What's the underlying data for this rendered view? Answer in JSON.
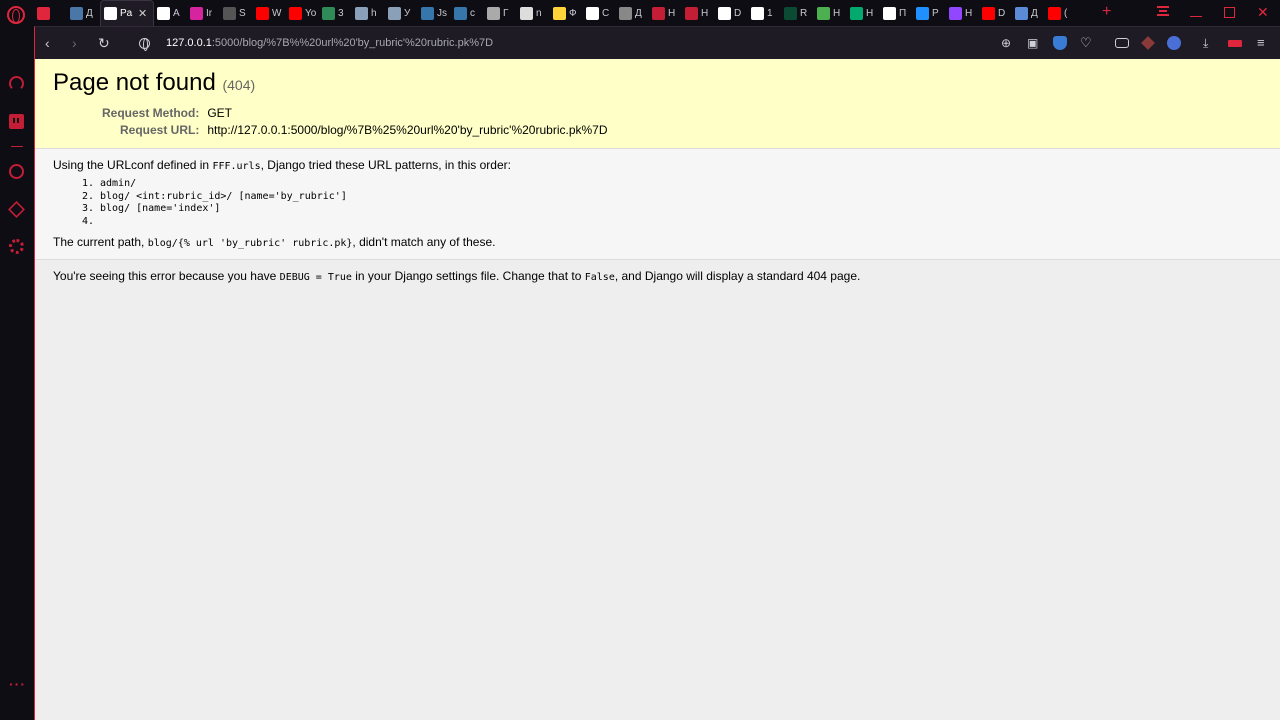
{
  "browser": {
    "tabs": [
      {
        "title": "",
        "favicon": "gamepad-icon",
        "color": "#e0263d"
      },
      {
        "title": "Д",
        "favicon": "vk-icon",
        "color": "#4a76a8"
      },
      {
        "title": "Pa",
        "favicon": "page-icon",
        "color": "#ffffff",
        "active": true
      },
      {
        "title": "A",
        "favicon": "page-icon",
        "color": "#ffffff"
      },
      {
        "title": "Ir",
        "favicon": "instagram-icon",
        "color": "#d6249f"
      },
      {
        "title": "S",
        "favicon": "gear-icon",
        "color": "#555555"
      },
      {
        "title": "W",
        "favicon": "youtube-icon",
        "color": "#ff0000"
      },
      {
        "title": "Yo",
        "favicon": "youtube-icon",
        "color": "#ff0000"
      },
      {
        "title": "3",
        "favicon": "refresh-icon",
        "color": "#2e8b57"
      },
      {
        "title": "h",
        "favicon": "h-icon",
        "color": "#8aa0b8"
      },
      {
        "title": "У",
        "favicon": "h-icon",
        "color": "#8aa0b8"
      },
      {
        "title": "Js",
        "favicon": "python-icon",
        "color": "#3776ab"
      },
      {
        "title": "c",
        "favicon": "python-icon",
        "color": "#3776ab"
      },
      {
        "title": "Г",
        "favicon": "bike-icon",
        "color": "#aaaaaa"
      },
      {
        "title": "n",
        "favicon": "book-icon",
        "color": "#dddddd"
      },
      {
        "title": "Ф",
        "favicon": "python-icon",
        "color": "#ffd43b"
      },
      {
        "title": "C",
        "favicon": "page-icon",
        "color": "#ffffff"
      },
      {
        "title": "Д",
        "favicon": "m-icon",
        "color": "#888888"
      },
      {
        "title": "Н",
        "favicon": "red-box-icon",
        "color": "#c41d36"
      },
      {
        "title": "Н",
        "favicon": "red-box-icon",
        "color": "#c41d36"
      },
      {
        "title": "D",
        "favicon": "wd-icon",
        "color": "#ffffff"
      },
      {
        "title": "1",
        "favicon": "page-icon",
        "color": "#ffffff"
      },
      {
        "title": "R",
        "favicon": "dj-icon",
        "color": "#0c4b33"
      },
      {
        "title": "Н",
        "favicon": "leaf-icon",
        "color": "#4caf50"
      },
      {
        "title": "Н",
        "favicon": "w3-icon",
        "color": "#04aa6d"
      },
      {
        "title": "П",
        "favicon": "page-icon",
        "color": "#ffffff"
      },
      {
        "title": "P",
        "favicon": "camera-icon",
        "color": "#1e90ff"
      },
      {
        "title": "Н",
        "favicon": "twitch-icon",
        "color": "#9146ff"
      },
      {
        "title": "D",
        "favicon": "youtube-icon",
        "color": "#ff0000"
      },
      {
        "title": "Д",
        "favicon": "chat-icon",
        "color": "#5b8bd6"
      },
      {
        "title": "(",
        "favicon": "youtube-icon",
        "color": "#ff0000"
      }
    ],
    "address": {
      "host": "127.0.0.1",
      "path": ":5000/blog/%7B%%20url%20'by_rubric'%20rubric.pk%7D"
    }
  },
  "error": {
    "title": "Page not found",
    "status": "(404)",
    "method_label": "Request Method:",
    "method": "GET",
    "url_label": "Request URL:",
    "url": "http://127.0.0.1:5000/blog/%7B%25%20url%20'by_rubric'%20rubric.pk%7D",
    "urlconf_prefix": "Using the URLconf defined in ",
    "urlconf_module": "FFF.urls",
    "urlconf_suffix": ", Django tried these URL patterns, in this order:",
    "patterns": [
      "admin/",
      "blog/ <int:rubric_id>/ [name='by_rubric']",
      "blog/ [name='index']",
      ""
    ],
    "current_prefix": "The current path, ",
    "current_path": "blog/{% url 'by_rubric' rubric.pk}",
    "current_suffix": ", didn't match any of these.",
    "debug_prefix": "You're seeing this error because you have ",
    "debug_code": "DEBUG = True",
    "debug_middle": " in your Django settings file. Change that to ",
    "debug_false": "False",
    "debug_suffix": ", and Django will display a standard 404 page."
  }
}
